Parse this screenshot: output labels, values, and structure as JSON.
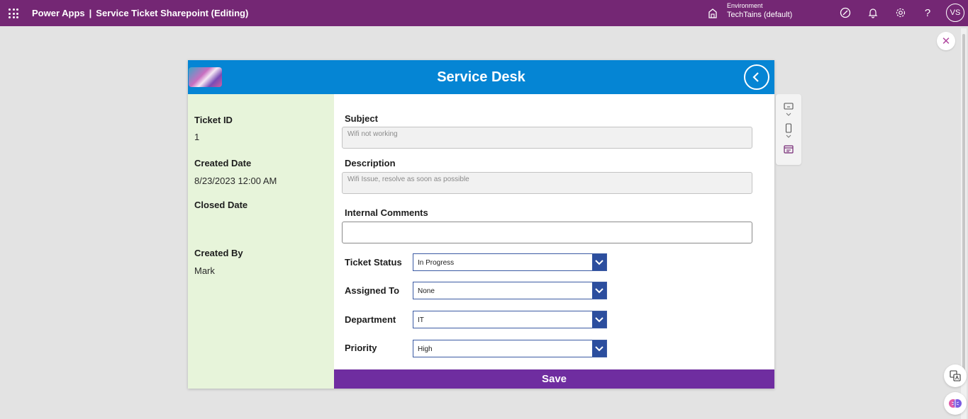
{
  "topbar": {
    "product": "Power Apps",
    "separator": "|",
    "app_name": "Service Ticket Sharepoint (Editing)",
    "environment_label": "Environment",
    "environment_name": "TechTains (default)",
    "avatar_initials": "VS"
  },
  "header": {
    "title": "Service Desk"
  },
  "left_panel": {
    "ticket_id_label": "Ticket ID",
    "ticket_id_value": "1",
    "created_date_label": "Created Date",
    "created_date_value": "8/23/2023 12:00 AM",
    "closed_date_label": "Closed Date",
    "closed_date_value": "",
    "created_by_label": "Created By",
    "created_by_value": "Mark"
  },
  "form": {
    "subject_label": "Subject",
    "subject_value": "Wifi not working",
    "description_label": "Description",
    "description_value": "Wifi Issue, resolve as soon as possible",
    "internal_comments_label": "Internal Comments",
    "internal_comments_value": "",
    "ticket_status_label": "Ticket Status",
    "ticket_status_value": "In Progress",
    "assigned_to_label": "Assigned To",
    "assigned_to_value": "None",
    "department_label": "Department",
    "department_value": "IT",
    "priority_label": "Priority",
    "priority_value": "High",
    "save_label": "Save"
  },
  "colors": {
    "topbar": "#742774",
    "header": "#0585d4",
    "left_panel": "#e7f4da",
    "save_bar": "#6f2da0",
    "dropdown_button": "#2c4e9e"
  },
  "icons": [
    "app-launcher-icon",
    "environment-icon",
    "copilot-icon",
    "notification-bell-icon",
    "settings-gear-icon",
    "help-icon",
    "back-arrow-icon",
    "close-icon",
    "chevron-down-icon",
    "screen-size-icon",
    "phone-size-icon",
    "calendar-icon",
    "translate-icon",
    "brain-icon"
  ]
}
